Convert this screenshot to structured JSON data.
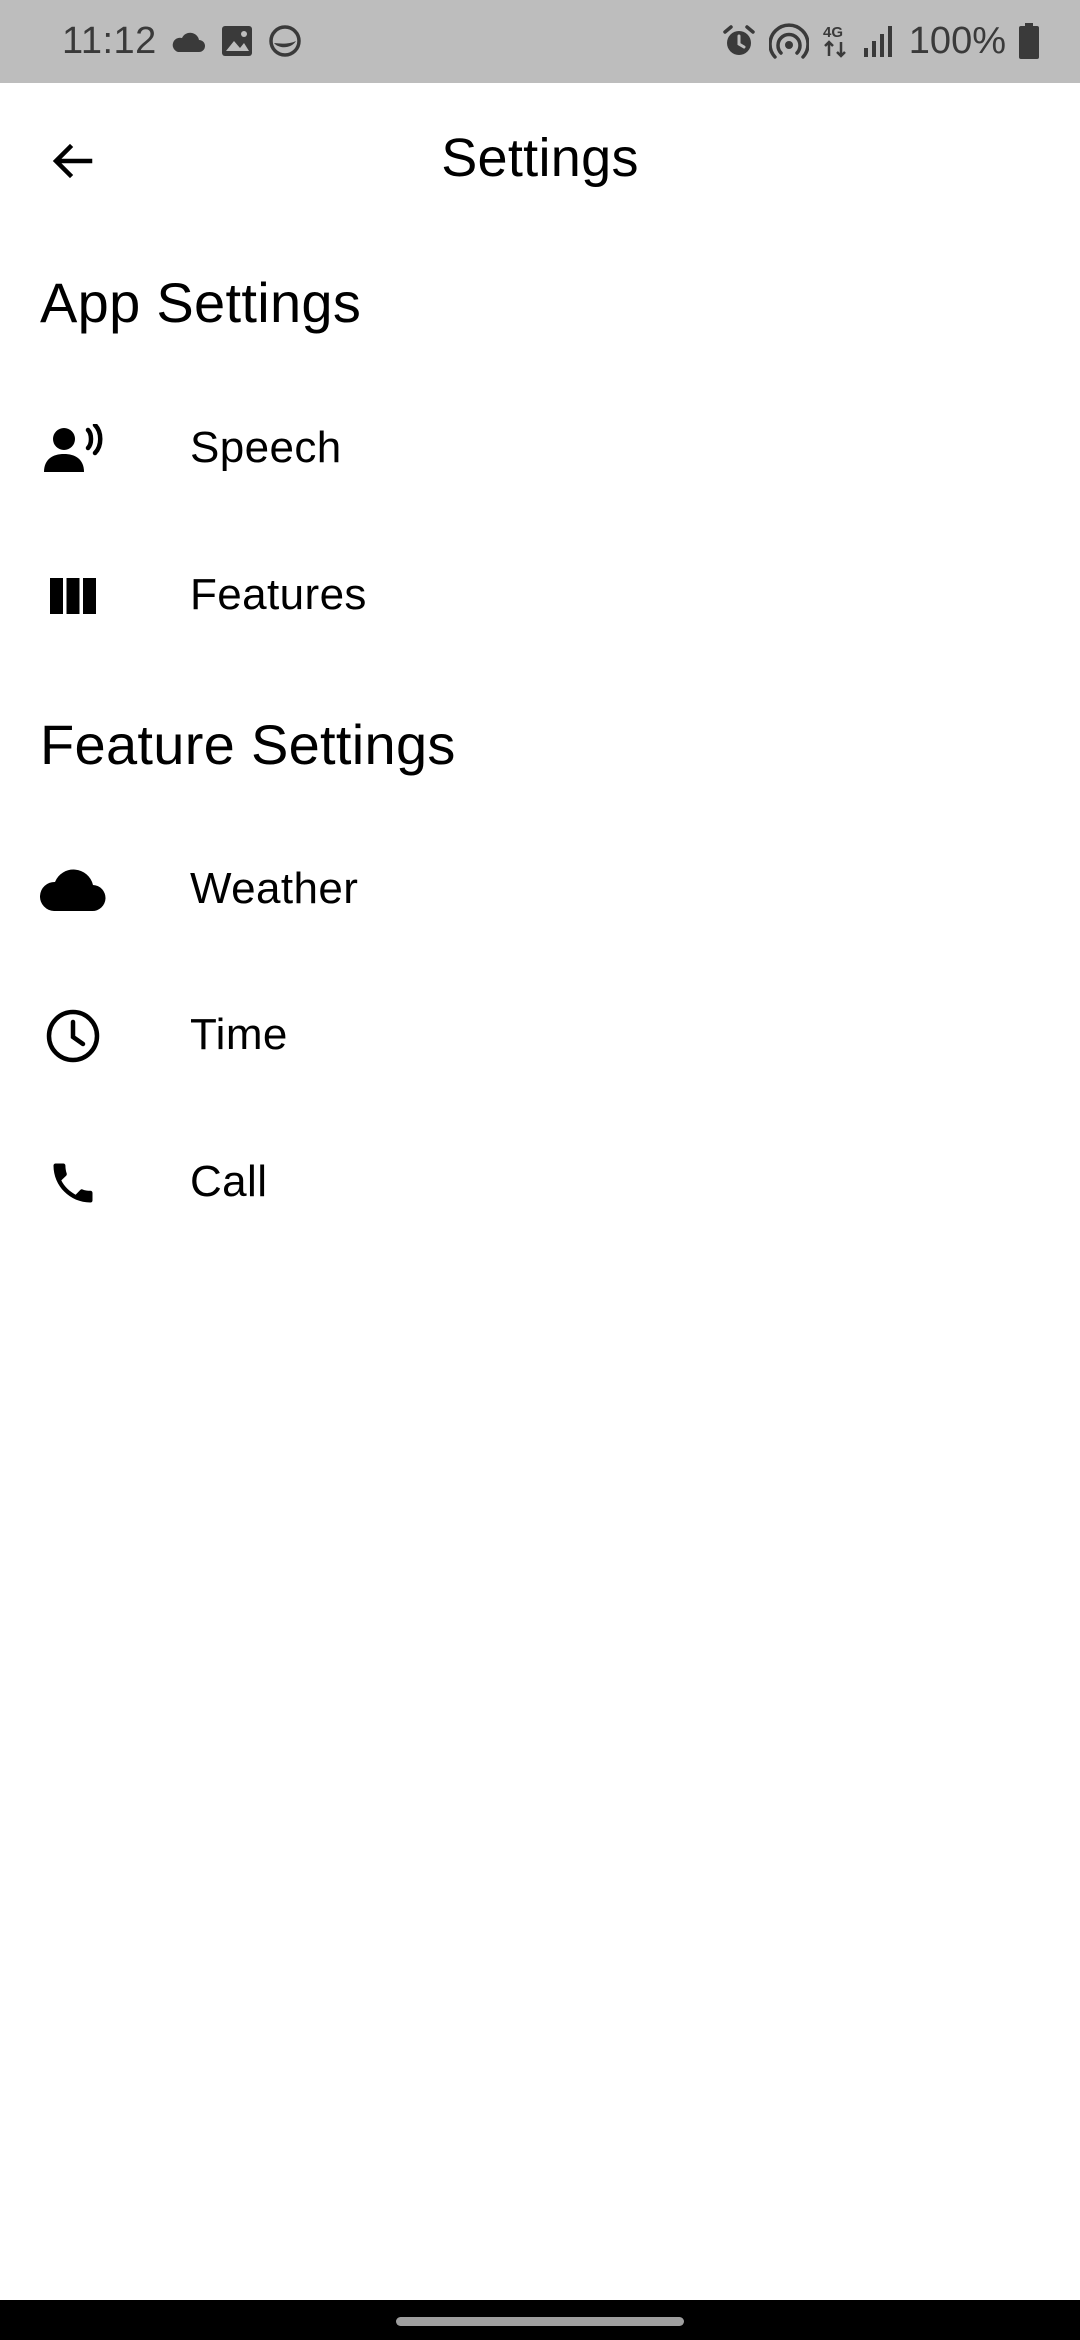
{
  "status_bar": {
    "time": "11:12",
    "battery": "100%",
    "left_icons": [
      "cloud-icon",
      "image-icon",
      "app-notification-icon"
    ],
    "right_icons": [
      "alarm-icon",
      "hotspot-icon",
      "4g-data-icon",
      "signal-icon",
      "battery-icon"
    ]
  },
  "app_bar": {
    "title": "Settings",
    "back_icon": "arrow-left-icon"
  },
  "sections": {
    "app": {
      "title": "App Settings",
      "items": [
        {
          "label": "Speech",
          "icon": "speaking-person-icon"
        },
        {
          "label": "Features",
          "icon": "view-column-icon"
        }
      ]
    },
    "feature": {
      "title": "Feature Settings",
      "items": [
        {
          "label": "Weather",
          "icon": "cloud-icon"
        },
        {
          "label": "Time",
          "icon": "clock-icon"
        },
        {
          "label": "Call",
          "icon": "phone-icon"
        }
      ]
    }
  },
  "colors": {
    "status_bar_bg": "#bdbdbd",
    "status_text": "#3a3a3a",
    "background": "#ffffff",
    "text": "#000000",
    "nav_bar": "#000000"
  }
}
